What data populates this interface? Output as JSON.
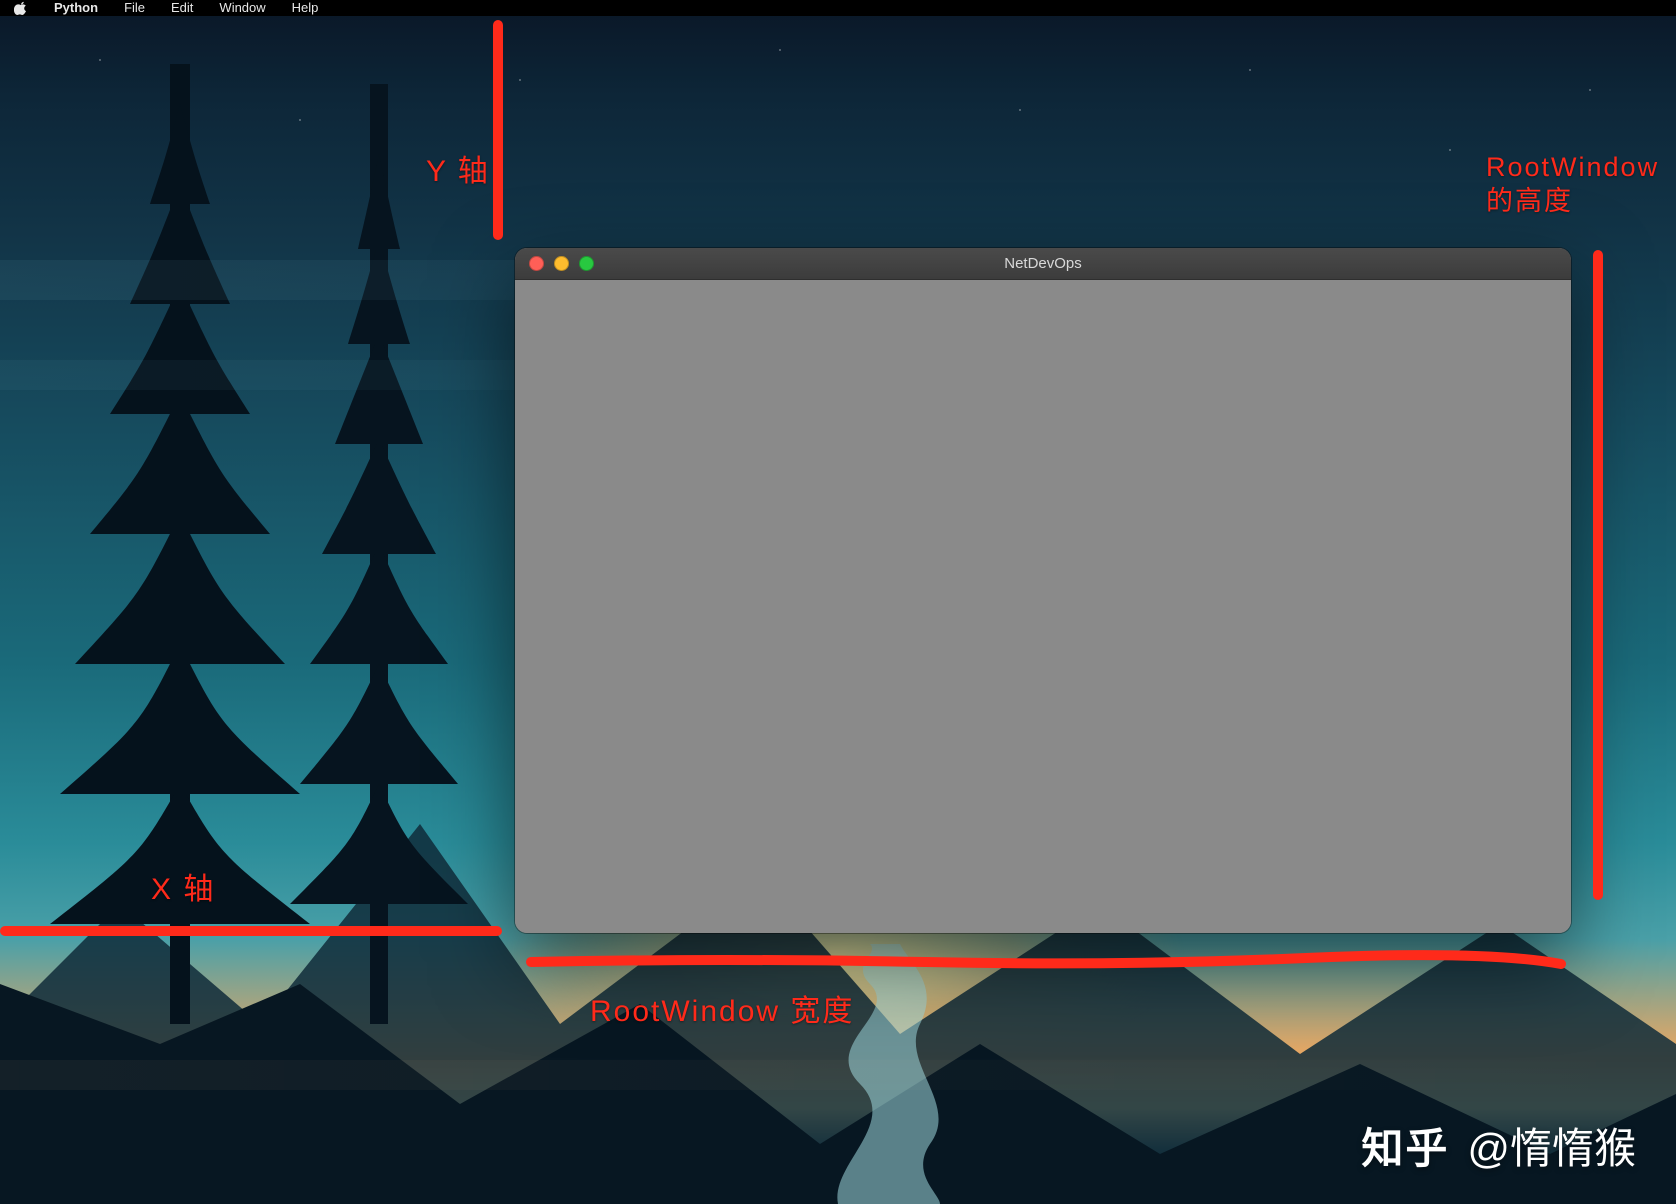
{
  "menubar": {
    "app_name": "Python",
    "items": [
      "File",
      "Edit",
      "Window",
      "Help"
    ]
  },
  "window": {
    "title": "NetDevOps"
  },
  "annotations": {
    "y_axis": "Y 轴",
    "x_axis": "X 轴",
    "root_height_line1": "RootWindow",
    "root_height_line2": "的高度",
    "root_width": "RootWindow 宽度"
  },
  "watermark": {
    "brand": "知乎",
    "handle": "@惰惰猴"
  },
  "colors": {
    "annotation": "#ff2a1a",
    "window_body": "#8a8a8a",
    "titlebar": "#3c3c3c"
  }
}
